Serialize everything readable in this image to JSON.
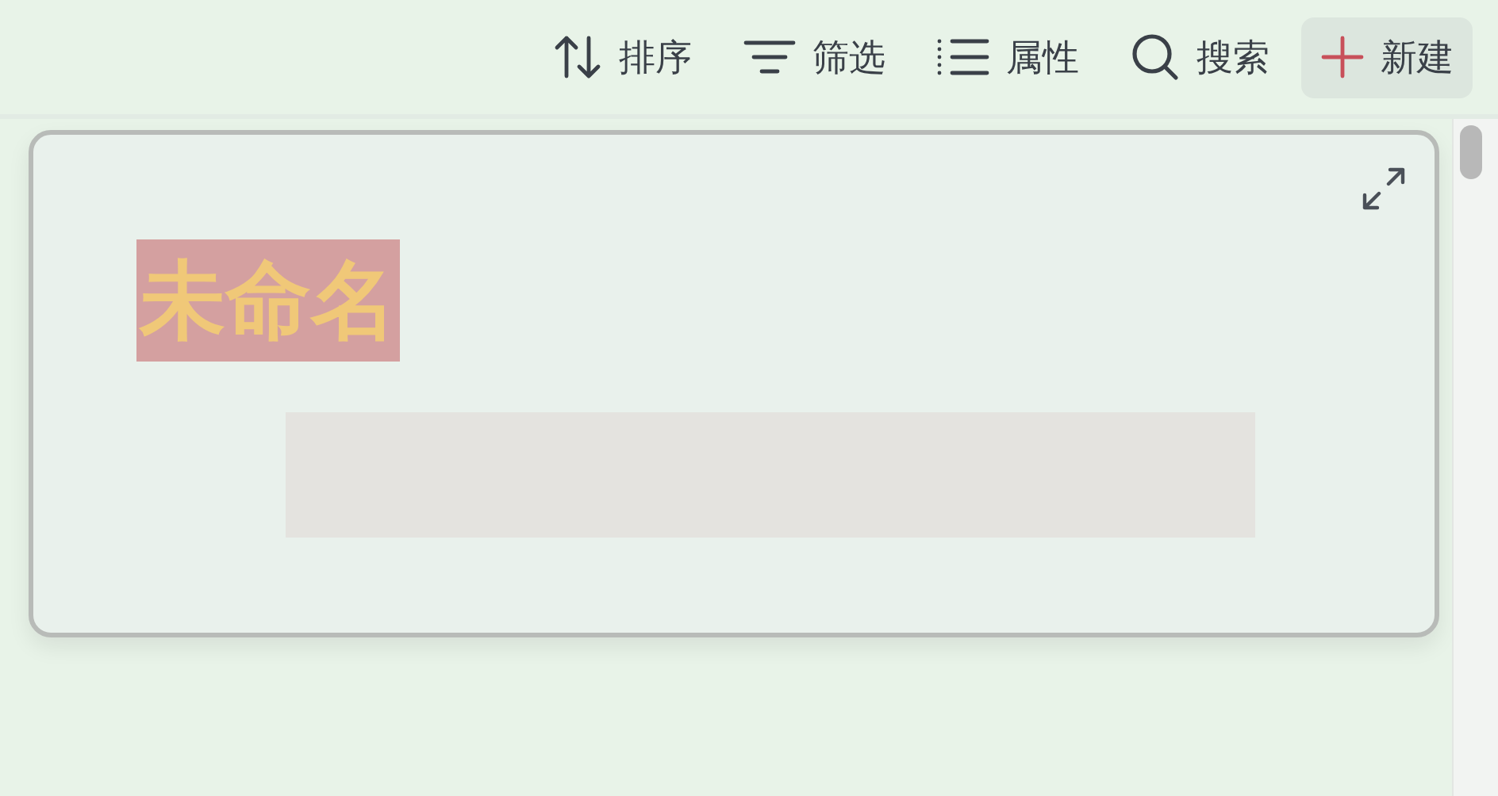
{
  "toolbar": {
    "buttons": [
      {
        "kind": "sort",
        "label": "排序"
      },
      {
        "kind": "filter",
        "label": "筛选"
      },
      {
        "kind": "properties",
        "label": "属性"
      },
      {
        "kind": "search",
        "label": "搜索"
      },
      {
        "kind": "new",
        "label": "新建"
      }
    ]
  },
  "card": {
    "title": "未命名"
  }
}
